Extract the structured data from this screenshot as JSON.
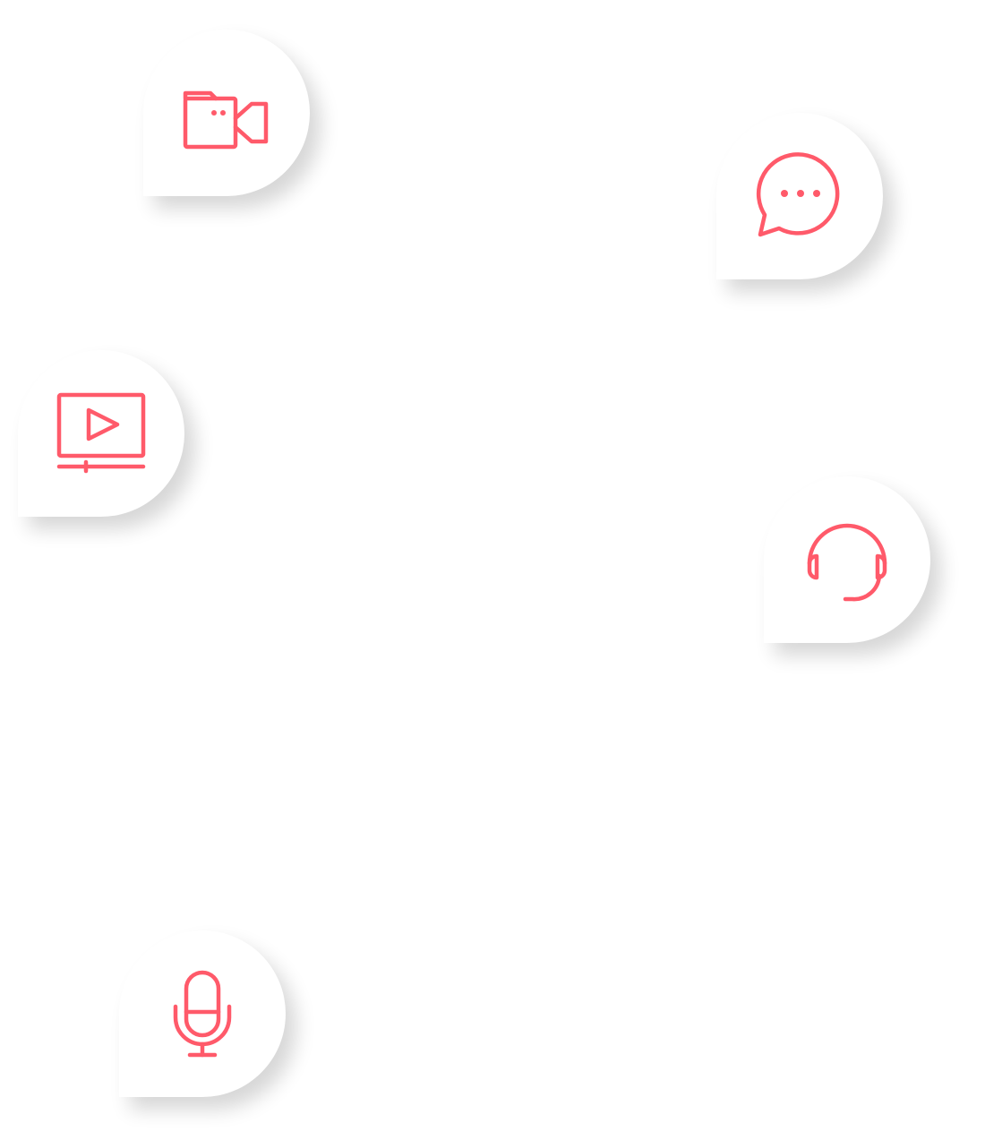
{
  "accent_color": "#ff5a6a",
  "background_color": "#ffffff",
  "bubbles": [
    {
      "id": "b-video",
      "icon": "video-camera-icon"
    },
    {
      "id": "b-chat",
      "icon": "chat-bubble-icon"
    },
    {
      "id": "b-play",
      "icon": "video-player-icon"
    },
    {
      "id": "b-support",
      "icon": "headset-icon"
    },
    {
      "id": "b-mic",
      "icon": "microphone-icon"
    }
  ]
}
